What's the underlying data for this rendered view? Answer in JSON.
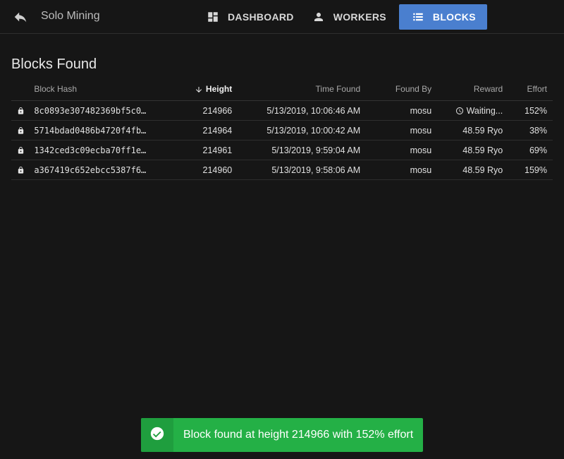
{
  "app": {
    "title": "Solo Mining"
  },
  "nav": {
    "items": [
      {
        "label": "DASHBOARD",
        "icon": "dashboard-icon"
      },
      {
        "label": "WORKERS",
        "icon": "person-icon"
      },
      {
        "label": "BLOCKS",
        "icon": "list-icon",
        "active": true
      }
    ]
  },
  "page": {
    "title": "Blocks Found"
  },
  "table": {
    "headers": {
      "hash": "Block Hash",
      "height": "Height",
      "time": "Time Found",
      "by": "Found By",
      "reward": "Reward",
      "effort": "Effort"
    },
    "sort": {
      "column": "height",
      "direction": "desc"
    },
    "rows": [
      {
        "hash": "8c0893e307482369bf5c0…",
        "height": "214966",
        "time": "5/13/2019, 10:06:46 AM",
        "by": "mosu",
        "reward": "Waiting...",
        "effort": "152%",
        "effort_status": "bad"
      },
      {
        "hash": "5714bdad0486b4720f4fb…",
        "height": "214964",
        "time": "5/13/2019, 10:00:42 AM",
        "by": "mosu",
        "reward": "48.59 Ryo",
        "effort": "38%",
        "effort_status": "good"
      },
      {
        "hash": "1342ced3c09ecba70ff1e…",
        "height": "214961",
        "time": "5/13/2019, 9:59:04 AM",
        "by": "mosu",
        "reward": "48.59 Ryo",
        "effort": "69%",
        "effort_status": "good"
      },
      {
        "hash": "a367419c652ebcc5387f6…",
        "height": "214960",
        "time": "5/13/2019, 9:58:06 AM",
        "by": "mosu",
        "reward": "48.59 Ryo",
        "effort": "159%",
        "effort_status": "bad"
      }
    ]
  },
  "toast": {
    "message": "Block found at height 214966 with 152% effort"
  },
  "colors": {
    "accent": "#4a7fcf",
    "background": "#161616",
    "success": "#24b046",
    "effort_good": "#86e08c",
    "effort_bad": "#e0262a"
  }
}
